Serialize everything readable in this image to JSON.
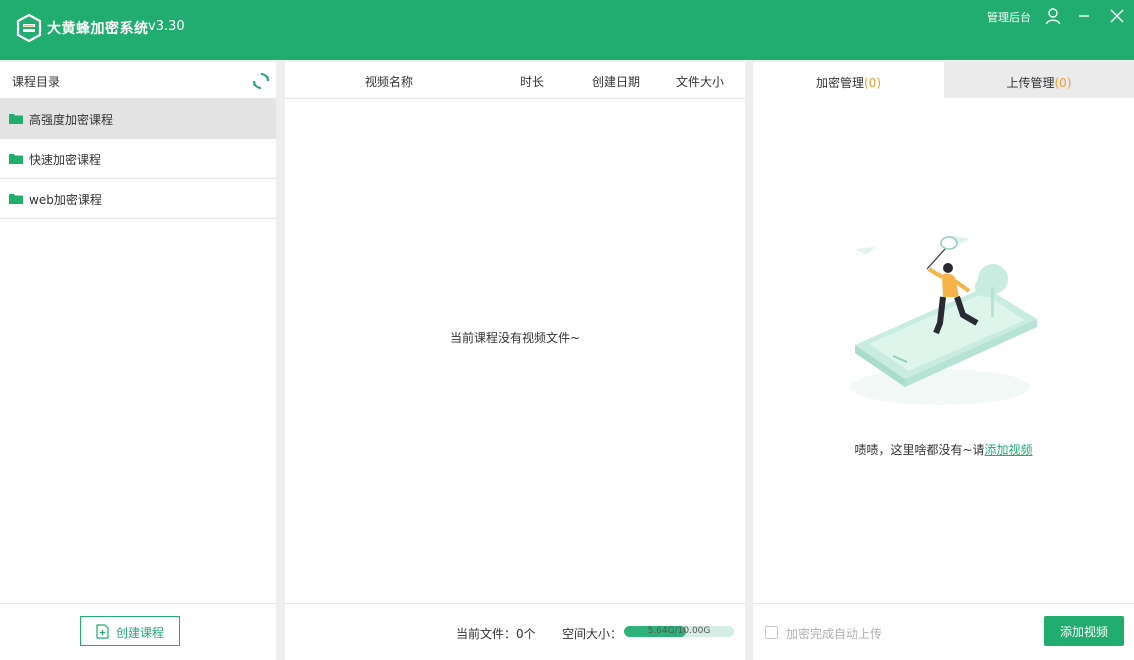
{
  "app": {
    "title": "大黄蜂加密系统",
    "version": "v3.30",
    "admin_link": "管理后台",
    "brand_color": "#21ad6f"
  },
  "sidebar": {
    "title": "课程目录",
    "items": [
      {
        "label": "高强度加密课程",
        "active": true
      },
      {
        "label": "快速加密课程",
        "active": false
      },
      {
        "label": "web加密课程",
        "active": false
      }
    ],
    "create_button": "创建课程"
  },
  "video_list": {
    "columns": [
      "视频名称",
      "时长",
      "创建日期",
      "文件大小"
    ],
    "empty_text": "当前课程没有视频文件~",
    "footer": {
      "files_label": "当前文件：0个",
      "space_label": "空间大小：",
      "space_used": "5.64G",
      "space_total": "10.00G",
      "space_display": "5.64G/10.00G",
      "space_fraction": 0.564
    }
  },
  "right_panel": {
    "tabs": [
      {
        "label": "加密管理",
        "count": "(0)"
      },
      {
        "label": "上传管理",
        "count": "(0)"
      }
    ],
    "empty_msg": "啧啧，这里啥都没有~请",
    "add_link": "添加视频",
    "auto_upload_label": "加密完成自动上传",
    "add_button": "添加视频"
  }
}
